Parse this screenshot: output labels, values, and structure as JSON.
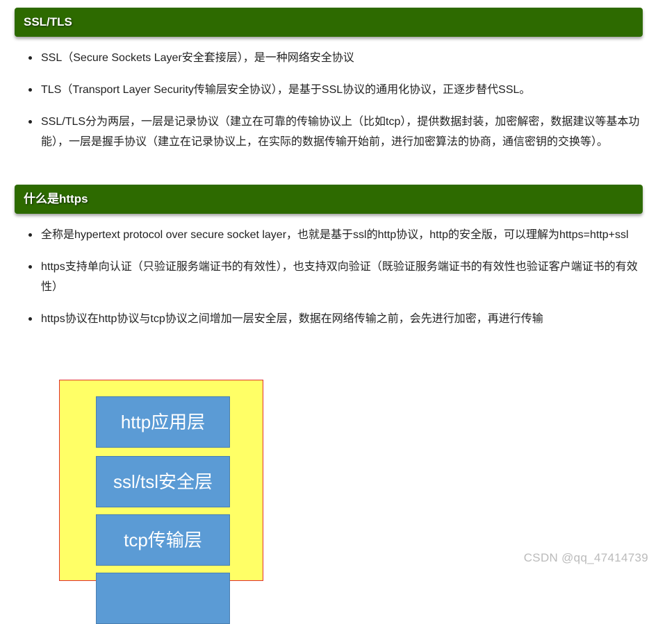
{
  "sections": [
    {
      "title": "SSL/TLS",
      "items": [
        "SSL（Secure Sockets Layer安全套接层），是一种网络安全协议",
        "TLS（Transport Layer Security传输层安全协议），是基于SSL协议的通用化协议，正逐步替代SSL。",
        "SSL/TLS分为两层，一层是记录协议（建立在可靠的传输协议上（比如tcp），提供数据封装，加密解密，数据建议等基本功能），一层是握手协议（建立在记录协议上，在实际的数据传输开始前，进行加密算法的协商，通信密钥的交换等）。"
      ]
    },
    {
      "title": "什么是https",
      "items": [
        "全称是hypertext protocol over secure socket layer，也就是基于ssl的http协议，http的安全版，可以理解为https=http+ssl",
        "https支持单向认证（只验证服务端证书的有效性），也支持双向验证（既验证服务端证书的有效性也验证客户端证书的有效性）",
        "https协议在http协议与tcp协议之间增加一层安全层，数据在网络传输之前，会先进行加密，再进行传输"
      ]
    }
  ],
  "diagram": {
    "layers": [
      "http应用层",
      "ssl/tsl安全层",
      "tcp传输层",
      ""
    ]
  },
  "watermark": "CSDN @qq_47414739",
  "colors": {
    "header_bg": "#2d6a00",
    "diagram_bg": "#ffff66",
    "diagram_border": "#e03030",
    "layer_bg": "#5b9bd5"
  }
}
